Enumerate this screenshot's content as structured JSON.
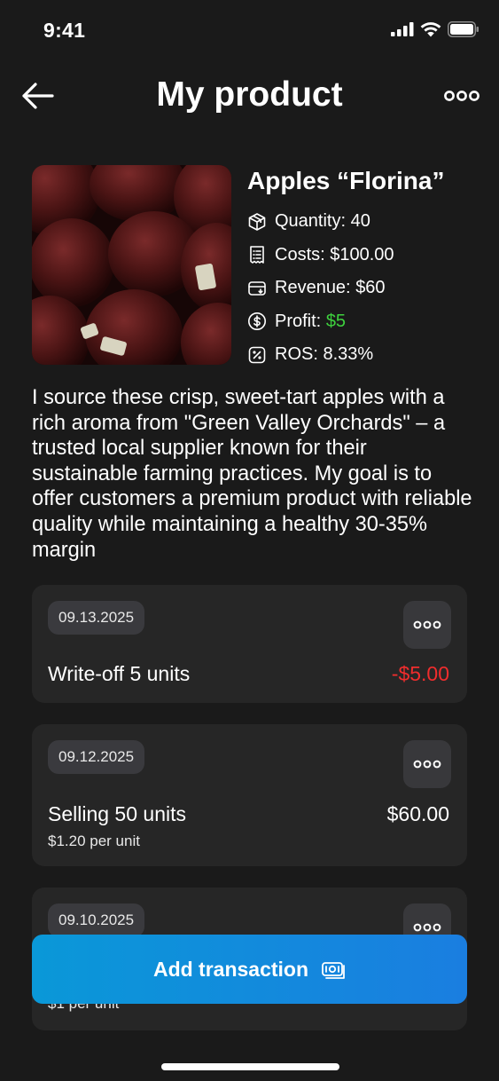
{
  "status": {
    "time": "9:41"
  },
  "nav": {
    "title": "My product"
  },
  "product": {
    "name": "Apples “Florina”",
    "stats": [
      {
        "label": "Quantity:",
        "value": "40",
        "icon": "box-icon"
      },
      {
        "label": "Costs:",
        "value": "$100.00",
        "icon": "receipt-icon"
      },
      {
        "label": "Revenue:",
        "value": "$60",
        "icon": "card-icon"
      },
      {
        "label": "Profit:",
        "value": "$5",
        "icon": "dollar-circle-icon"
      },
      {
        "label": "ROS:",
        "value": "8.33%",
        "icon": "percent-icon"
      }
    ],
    "description": "I source these crisp, sweet-tart apples with a rich aroma from \"Green Valley Orchards\" – a trusted local supplier known for their sustainable farming practices. My goal is to offer customers a premium product with reliable quality while maintaining a healthy 30-35% margin"
  },
  "transactions": [
    {
      "date": "09.13.2025",
      "title": "Write-off 5 units",
      "amount": "-$5.00",
      "sub": ""
    },
    {
      "date": "09.12.2025",
      "title": "Selling 50 units",
      "amount": "$60.00",
      "sub": "$1.20 per unit"
    },
    {
      "date": "09.10.2025",
      "title": "",
      "amount": "",
      "sub": "$1 per unit"
    }
  ],
  "actions": {
    "add_transaction": "Add transaction"
  },
  "colors": {
    "profit": "#3ed13e",
    "negative": "#f02d2d",
    "accent": "#0a98d8"
  }
}
